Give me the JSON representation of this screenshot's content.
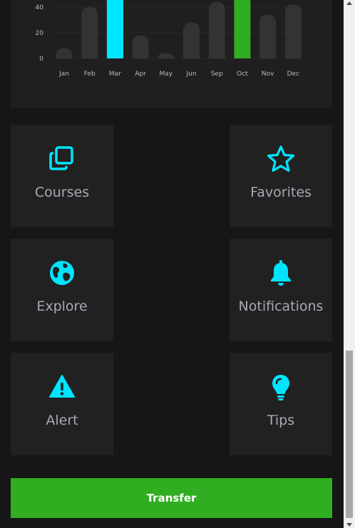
{
  "chart_data": {
    "type": "bar",
    "categories": [
      "Jan",
      "Feb",
      "Mar",
      "Apr",
      "May",
      "Jun",
      "Sep",
      "Oct",
      "Nov",
      "Dec"
    ],
    "values": [
      8,
      40,
      60,
      18,
      4,
      28,
      44,
      60,
      34,
      42
    ],
    "highlight": {
      "Mar": "#00e5ff",
      "Oct": "#31ad22"
    },
    "bar_color": "#333333",
    "yticks": [
      "0",
      "20",
      "40"
    ],
    "ylim": [
      0,
      60
    ]
  },
  "tiles": [
    {
      "label": "Courses",
      "icon": "copy-icon"
    },
    {
      "label": "Favorites",
      "icon": "star-icon"
    },
    {
      "label": "Explore",
      "icon": "globe-icon"
    },
    {
      "label": "Notifications",
      "icon": "bell-icon"
    },
    {
      "label": "Alert",
      "icon": "warning-icon"
    },
    {
      "label": "Tips",
      "icon": "lightbulb-icon"
    }
  ],
  "transfer_label": "Transfer",
  "colors": {
    "accent": "#00e5ff",
    "green": "#31ad22"
  }
}
